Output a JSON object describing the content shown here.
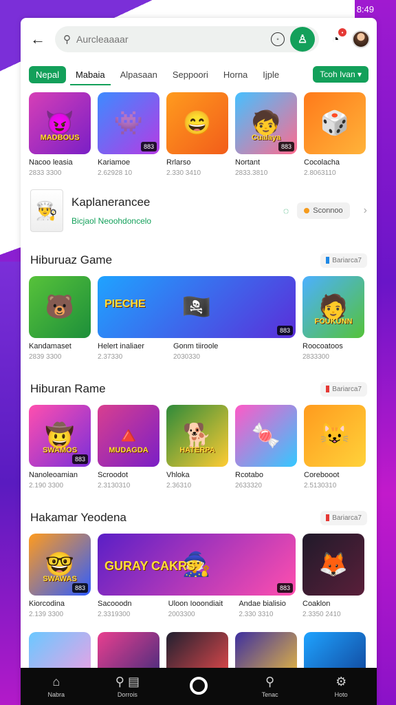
{
  "status": {
    "time": "8:49"
  },
  "search": {
    "placeholder": "Aurcleaaaar"
  },
  "tabs": [
    "Nepal",
    "Mabaia",
    "Alpasaan",
    "Seppoori",
    "Horna",
    "Ijple"
  ],
  "filter_label": "Tcoh Ivan ▾",
  "row1": [
    {
      "title": "MADBOUS",
      "name": "Nacoo leasia",
      "meta": "2833 3300",
      "tag": "",
      "bg": "linear-gradient(135deg,#d63fb6,#7a1fc6)"
    },
    {
      "title": "",
      "name": "Kariamoe",
      "meta": "2.62928 10",
      "tag": "883",
      "bg": "linear-gradient(135deg,#3d8bff,#b53be4)"
    },
    {
      "title": "",
      "name": "Rrlarso",
      "meta": "2.330 3410",
      "tag": "",
      "bg": "linear-gradient(135deg,#ff9b1e,#f25d1a)"
    },
    {
      "title": "Cualaya",
      "name": "Nortant",
      "meta": "2833.3810",
      "tag": "883",
      "bg": "linear-gradient(135deg,#46c0ff,#ff6b8e)"
    },
    {
      "title": "",
      "name": "Cocolacha",
      "meta": "2.8063110",
      "tag": "",
      "bg": "linear-gradient(135deg,#ff7a1a,#ffb33a)"
    }
  ],
  "promo": {
    "title": "Kaplanerancee",
    "subtitle": "Bicjaol Neoohdoncelo",
    "chip": "Sconnoo"
  },
  "section1": {
    "title": "Hiburuaz Game",
    "more": "Bariarca7",
    "items": [
      {
        "title": "",
        "name": "Kandamaset",
        "meta": "2839 3300",
        "tag": "",
        "bg": "linear-gradient(135deg,#57c23a,#1d8f3a)"
      },
      {
        "title": "PIECHE",
        "name": "Helert inaliaer",
        "meta": "2.37330",
        "tag": "883",
        "bg": "linear-gradient(135deg,#1fa3ff,#5a2fd9)"
      },
      {
        "title": "FOUKUNN",
        "name": "Roocoatoos",
        "meta": "2833300",
        "tag": "",
        "bg": "linear-gradient(135deg,#4cb0ff,#55c23a)"
      }
    ],
    "wide_name2": "Gonm tiiroole",
    "wide_meta2": "2030330"
  },
  "section2": {
    "title": "Hiburan Rame",
    "more": "Bariarca7",
    "items": [
      {
        "title": "SWAMOS",
        "name": "Nanoleoamian",
        "meta": "2.190 3300",
        "tag": "883",
        "bg": "linear-gradient(135deg,#ff4fae,#7a2fd9)"
      },
      {
        "title": "MUDAGDA",
        "name": "Scroodot",
        "meta": "2.3130310",
        "tag": "",
        "bg": "linear-gradient(135deg,#d93f8f,#7a1fc6)"
      },
      {
        "title": "HATERPA",
        "name": "Vhloka",
        "meta": "2.36310",
        "tag": "",
        "bg": "linear-gradient(135deg,#2e8a3a,#ffcc33)"
      },
      {
        "title": "",
        "name": "Rcotabo",
        "meta": "2633320",
        "tag": "",
        "bg": "linear-gradient(135deg,#ff59c6,#33c8ff)"
      },
      {
        "title": "",
        "name": "Corebooot",
        "meta": "2.5130310",
        "tag": "",
        "bg": "linear-gradient(135deg,#ff9b1e,#ffd23a)"
      }
    ]
  },
  "section3": {
    "title": "Hakamar Yeodena",
    "more": "Bariarca7",
    "items": [
      {
        "title": "SWAWAS",
        "name": "Kiorcodina",
        "meta": "2.139 3300",
        "tag": "883",
        "bg": "linear-gradient(135deg,#ff9b1e,#2e5cff)"
      },
      {
        "title": "GURAY CAKRS",
        "name": "Sacooodn",
        "meta": "2.3319300",
        "tag": "",
        "bg": "linear-gradient(135deg,#5a1fc6,#ff4fae)"
      },
      {
        "title": "",
        "name": "Andae bialisio",
        "meta": "2.330 3310",
        "tag": "883",
        "bg": "linear-gradient(135deg,#5a1fc6,#ff59c6)"
      },
      {
        "title": "",
        "name": "Coaklon",
        "meta": "2.3350 2410",
        "tag": "",
        "bg": "linear-gradient(135deg,#201a2a,#5a1f3a)"
      }
    ],
    "wide_name2": "Uloon Iooondiait",
    "wide_meta2": "2003300"
  },
  "row_last": [
    {
      "bg": "linear-gradient(135deg,#6ac8ff,#ff9be0)"
    },
    {
      "bg": "linear-gradient(135deg,#e93f8f,#2e2a7a)"
    },
    {
      "bg": "linear-gradient(135deg,#202030,#ff4f4f)"
    },
    {
      "bg": "linear-gradient(135deg,#3d2fa0,#ffcc33)"
    },
    {
      "bg": "linear-gradient(135deg,#1fa3ff,#0f3a8f)"
    }
  ],
  "nav": [
    {
      "label": "Nabra",
      "icon": "home-icon"
    },
    {
      "label": "Dorrois",
      "icon": "search-icon"
    },
    {
      "label": "",
      "icon": "record-icon"
    },
    {
      "label": "Tenac",
      "icon": "search-icon"
    },
    {
      "label": "Hoto",
      "icon": "gear-icon"
    }
  ]
}
